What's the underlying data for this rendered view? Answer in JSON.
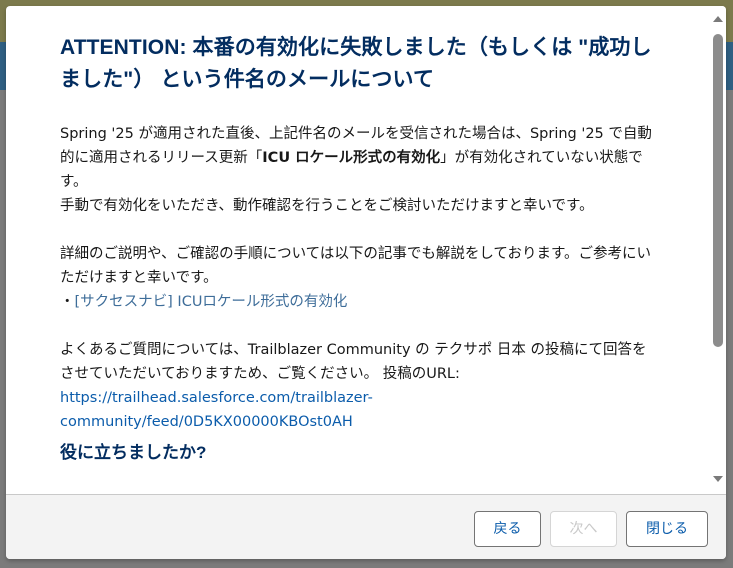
{
  "modal": {
    "title": "ATTENTION: 本番の有効化に失敗しました（もしくは \"成功しました\"） という件名のメールについて",
    "paragraph1_pre": "Spring '25 が適用された直後、上記件名のメールを受信された場合は、Spring '25 で自動的に適用されるリリース更新「",
    "paragraph1_strong": "ICU ロケール形式の有効化",
    "paragraph1_post": "」が有効化されていない状態です。",
    "paragraph2": "手動で有効化をいただき、動作確認を行うことをご検討いただけますと幸いです。",
    "paragraph3": "詳細のご説明や、ご確認の手順については以下の記事でも解説をしております。ご参考にいただけますと幸いです。",
    "bullet_prefix": "・",
    "bullet_link": "[サクセスナビ] ICUロケール形式の有効化",
    "paragraph4": "よくあるご質問については、Trailblazer Community の テクサポ 日本 の投稿にて回答をさせていただいておりますため、ご覧ください。 投稿のURL:",
    "url_line1": "https://trailhead.salesforce.com/trailblazer-",
    "url_line2": "community/feed/0D5KX00000KBOst0AH",
    "helpful_question": "役に立ちましたか?"
  },
  "footer": {
    "back_label": "戻る",
    "next_label": "次へ",
    "close_label": "閉じる"
  },
  "colors": {
    "title": "#032d60",
    "link": "#0b5cab",
    "button_text": "#0b5cab",
    "disabled_text": "#c9c9c9"
  }
}
